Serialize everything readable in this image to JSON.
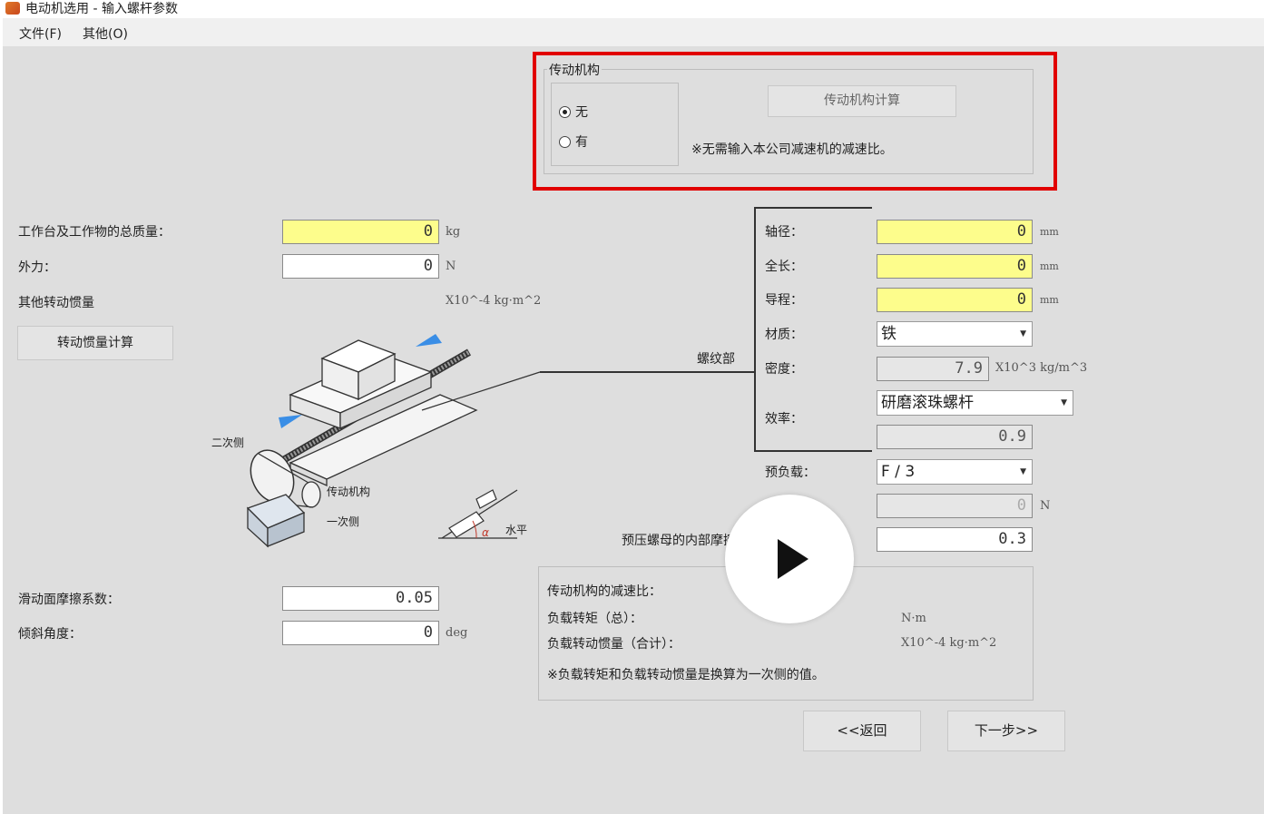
{
  "window": {
    "title": "电动机选用 - 输入螺杆参数"
  },
  "menu": [
    "文件(F)",
    "其他(O)"
  ],
  "transmission": {
    "group_label": "传动机构",
    "option_none": "无",
    "option_has": "有",
    "selected": "无",
    "calc_button": "传动机构计算",
    "note": "※无需输入本公司减速机的减速比。"
  },
  "left": {
    "total_mass_label": "工作台及工作物的总质量：",
    "total_mass_value": "0",
    "total_mass_unit": "kg",
    "external_force_label": "外力：",
    "external_force_value": "0",
    "external_force_unit": "N",
    "other_inertia_label": "其他转动惯量",
    "other_inertia_unit": "X10^-4 kg·m^2",
    "inertia_calc_button": "转动惯量计算",
    "friction_label": "滑动面摩擦系数：",
    "friction_value": "0.05",
    "tilt_label": "倾斜角度：",
    "tilt_value": "0",
    "tilt_unit": "deg"
  },
  "diagram": {
    "secondary_side": "二次侧",
    "transmission": "传动机构",
    "primary_side": "一次侧",
    "horizontal": "水平",
    "alpha": "α",
    "thread_part": "螺纹部"
  },
  "screw": {
    "shaft_diameter_label": "轴径：",
    "shaft_diameter_value": "0",
    "shaft_diameter_unit": "mm",
    "length_label": "全长：",
    "length_value": "0",
    "length_unit": "mm",
    "lead_label": "导程：",
    "lead_value": "0",
    "lead_unit": "mm",
    "material_label": "材质：",
    "material_value": "铁",
    "density_label": "密度：",
    "density_value": "7.9",
    "density_unit": "X10^3 kg/m^3",
    "efficiency_label": "效率：",
    "efficiency_type": "研磨滚珠螺杆",
    "efficiency_value": "0.9",
    "preload_label": "预负载：",
    "preload_type": "F / 3",
    "preload_value": "0",
    "preload_unit": "N",
    "nut_friction_label": "预压螺母的内部摩擦系数",
    "nut_friction_value": "0.3"
  },
  "results": {
    "ratio_label": "传动机构的减速比：",
    "load_torque_label": "负载转矩（总）：",
    "load_torque_unit": "N·m",
    "load_inertia_label": "负载转动惯量（合计）：",
    "load_inertia_unit": "X10^-4 kg·m^2",
    "note": "※负载转矩和负载转动惯量是换算为一次侧的值。"
  },
  "nav": {
    "back": "<<返回",
    "next": "下一步>>"
  },
  "colors": {
    "highlight": "#e10000",
    "required_field": "#fdfd8c",
    "accent_arrow": "#3a8ee6"
  }
}
